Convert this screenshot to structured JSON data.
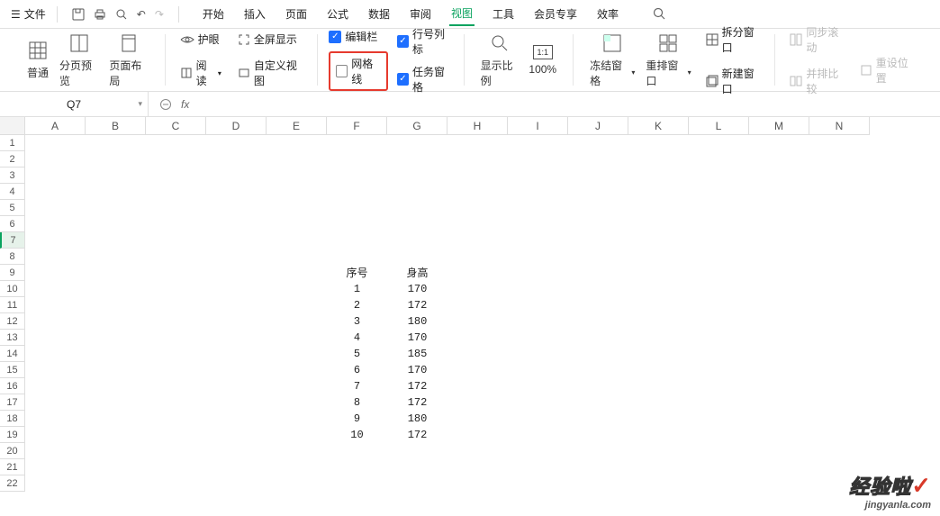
{
  "menubar": {
    "file": "文件",
    "tabs": [
      "开始",
      "插入",
      "页面",
      "公式",
      "数据",
      "审阅",
      "视图",
      "工具",
      "会员专享",
      "效率"
    ],
    "active_tab": "视图"
  },
  "ribbon": {
    "views": {
      "normal": "普通",
      "page_break": "分页预览",
      "page_layout": "页面布局"
    },
    "eye": "护眼",
    "fullscreen": "全屏显示",
    "read": "阅读",
    "custom_view": "自定义视图",
    "checks": {
      "formula_bar": "编辑栏",
      "headings": "行号列标",
      "gridlines": "网格线",
      "task_pane": "任务窗格"
    },
    "zoom": "显示比例",
    "zoom_pct": "100%",
    "freeze": "冻结窗格",
    "arrange": "重排窗口",
    "split": "拆分窗口",
    "new_window": "新建窗口",
    "sync_scroll": "同步滚动",
    "side_by_side": "并排比较",
    "reset_pos": "重设位置"
  },
  "namebox": "Q7",
  "columns": [
    "A",
    "B",
    "C",
    "D",
    "E",
    "F",
    "G",
    "H",
    "I",
    "J",
    "K",
    "L",
    "M",
    "N"
  ],
  "row_count": 22,
  "selected_row": 7,
  "chart_data": {
    "type": "table",
    "title": "",
    "header_row": 9,
    "col_F": "序号",
    "col_G": "身高",
    "rows": [
      {
        "序号": 1,
        "身高": 170
      },
      {
        "序号": 2,
        "身高": 172
      },
      {
        "序号": 3,
        "身高": 180
      },
      {
        "序号": 4,
        "身高": 170
      },
      {
        "序号": 5,
        "身高": 185
      },
      {
        "序号": 6,
        "身高": 170
      },
      {
        "序号": 7,
        "身高": 172
      },
      {
        "序号": 8,
        "身高": 172
      },
      {
        "序号": 9,
        "身高": 180
      },
      {
        "序号": 10,
        "身高": 172
      }
    ]
  },
  "watermark": {
    "line1": "经验啦",
    "line2": "jingyanla.com"
  }
}
